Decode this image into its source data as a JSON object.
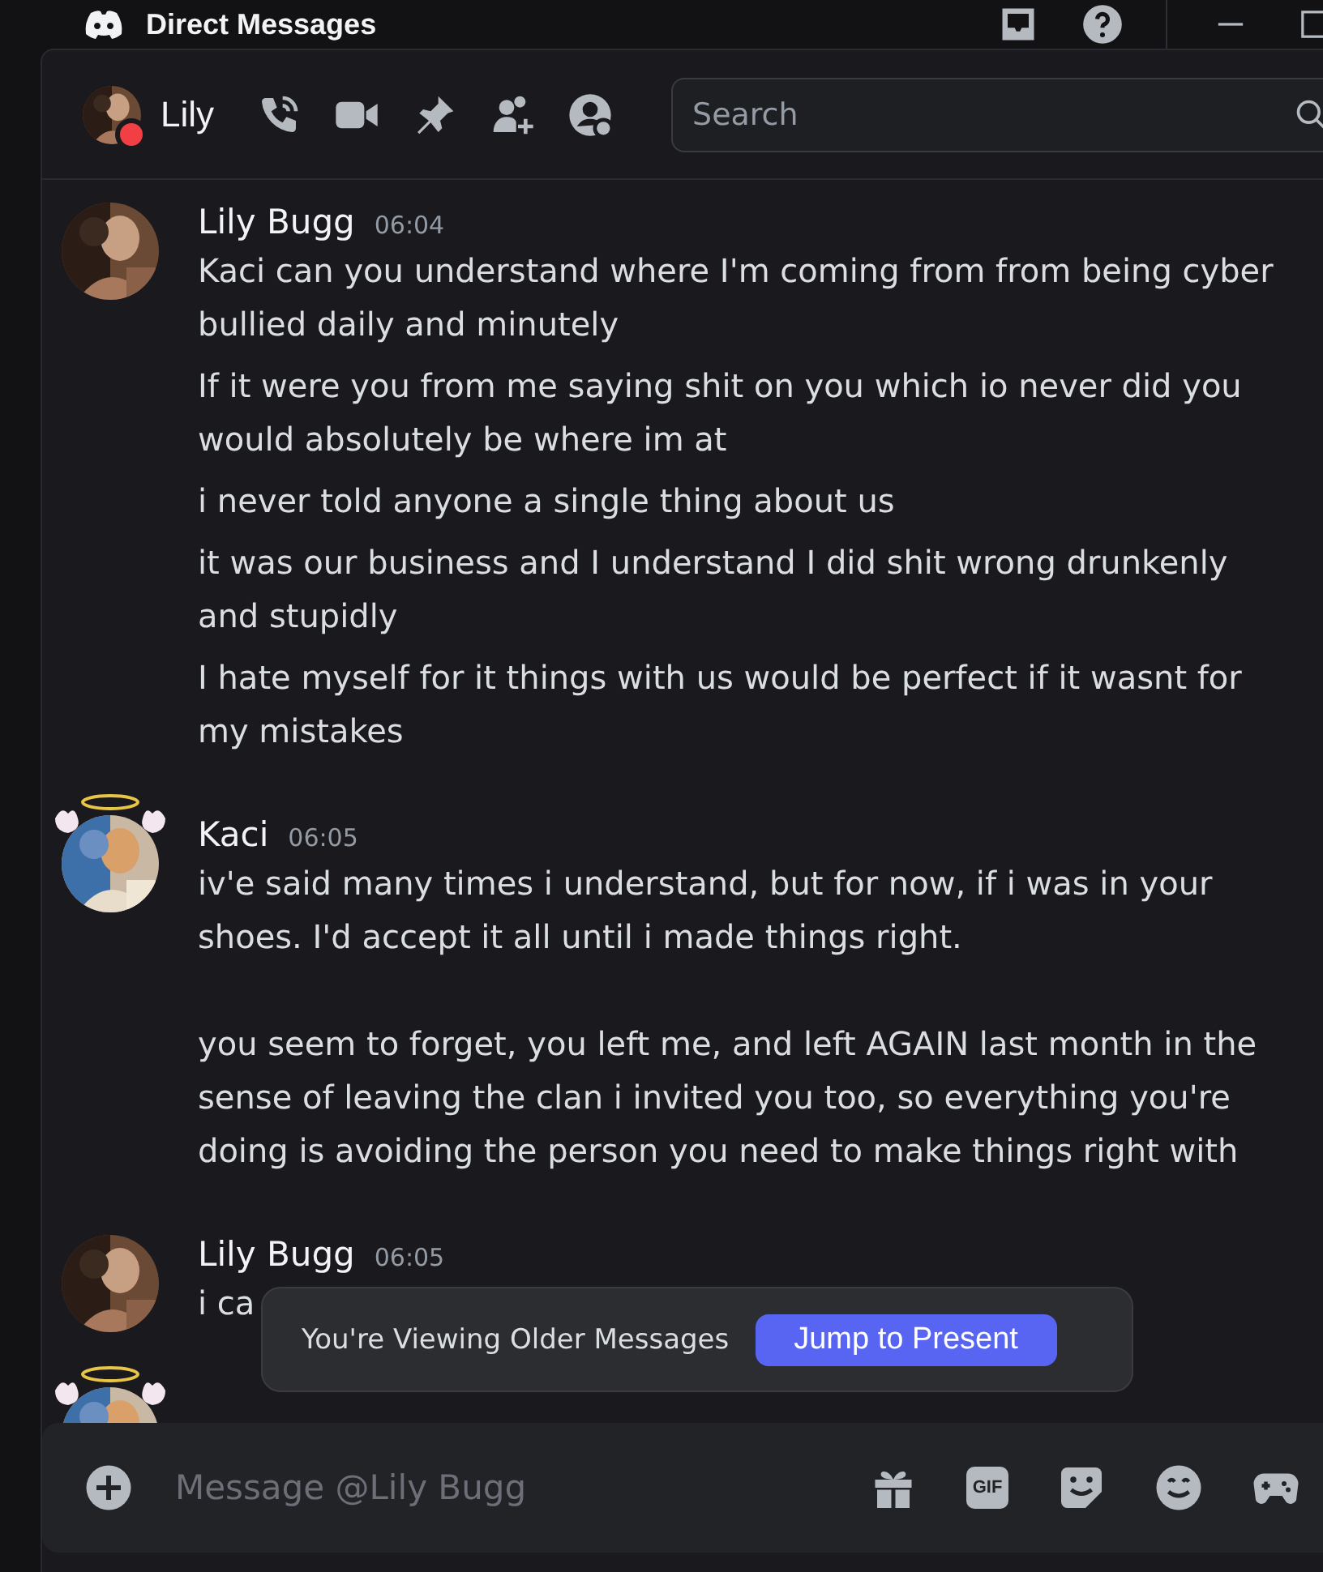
{
  "window": {
    "title": "Direct Messages"
  },
  "header": {
    "user": {
      "name": "Lily",
      "color": "#f23f43"
    },
    "search": {
      "placeholder": "Search"
    }
  },
  "messages": [
    {
      "author": "Lily Bugg",
      "time": "06:04",
      "kind": "plain",
      "paragraphs": [
        "Kaci can you understand where I'm coming from from being cyber bullied daily and minutely",
        "If it were you from me saying shit on you which io never did you would absolutely be where im at",
        "i never told anyone a single thing about us",
        "it was our business and I understand I did shit wrong drunkenly and stupidly",
        "I hate myself for it things with us would be perfect if it wasnt for my mistakes"
      ]
    },
    {
      "author": "Kaci",
      "time": "06:05",
      "kind": "halo",
      "paragraphs": [
        "iv'e said many times i understand, but for now, if i was in your shoes. I'd accept it all until i made things right.\n\nyou seem to forget, you left me, and left AGAIN last month in the sense of leaving the clan i invited you too, so everything you're doing is avoiding the person you need to make things right with"
      ]
    },
    {
      "author": "Lily Bugg",
      "time": "06:05",
      "kind": "plain",
      "paragraphs": [
        "i ca"
      ]
    },
    {
      "kind": "halo"
    }
  ],
  "older_notice": {
    "text": "You're Viewing Older Messages",
    "button": "Jump to Present"
  },
  "composer": {
    "placeholder": "Message @Lily Bugg",
    "gif_label": "GIF"
  }
}
